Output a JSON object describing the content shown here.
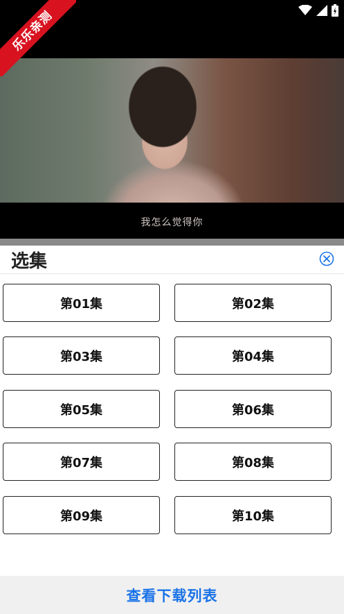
{
  "corner_ribbon": {
    "text": "乐乐亲测"
  },
  "video": {
    "subtitle": "我怎么觉得你"
  },
  "panel": {
    "title": "选集",
    "close_icon": "close-circle-icon",
    "episodes": [
      "第01集",
      "第02集",
      "第03集",
      "第04集",
      "第05集",
      "第06集",
      "第07集",
      "第08集",
      "第09集",
      "第10集"
    ],
    "download_list_label": "查看下载列表"
  },
  "colors": {
    "accent": "#1a73e8",
    "ribbon": "#d8121f"
  }
}
